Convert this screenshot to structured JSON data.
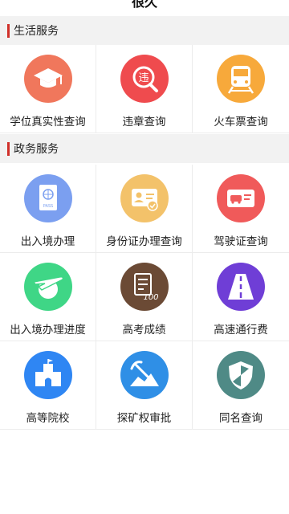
{
  "header": {
    "title": "很久"
  },
  "sections": [
    {
      "title": "生活服务",
      "items": [
        {
          "label": "学位真实性查询",
          "icon": "graduation-cap-icon",
          "color": "#f0775c"
        },
        {
          "label": "违章查询",
          "icon": "violation-search-icon",
          "color": "#ef4b4e"
        },
        {
          "label": "火车票查询",
          "icon": "train-icon",
          "color": "#f7a93b"
        }
      ]
    },
    {
      "title": "政务服务",
      "items": [
        {
          "label": "出入境办理",
          "icon": "passport-icon",
          "color": "#7b9ff0"
        },
        {
          "label": "身份证办理查询",
          "icon": "id-card-icon",
          "color": "#f3c26a"
        },
        {
          "label": "驾驶证查询",
          "icon": "driving-license-icon",
          "color": "#f05a5a"
        },
        {
          "label": "出入境办理进度",
          "icon": "airplane-globe-icon",
          "color": "#3fd686"
        },
        {
          "label": "高考成绩",
          "icon": "exam-score-icon",
          "color": "#6b4a35"
        },
        {
          "label": "高速通行费",
          "icon": "highway-icon",
          "color": "#6f3ed6"
        },
        {
          "label": "高等院校",
          "icon": "university-building-icon",
          "color": "#2f86f3"
        },
        {
          "label": "探矿权审批",
          "icon": "mining-icon",
          "color": "#2f8fe6"
        },
        {
          "label": "同名查询",
          "icon": "shield-icon",
          "color": "#4f8a86"
        }
      ]
    }
  ]
}
